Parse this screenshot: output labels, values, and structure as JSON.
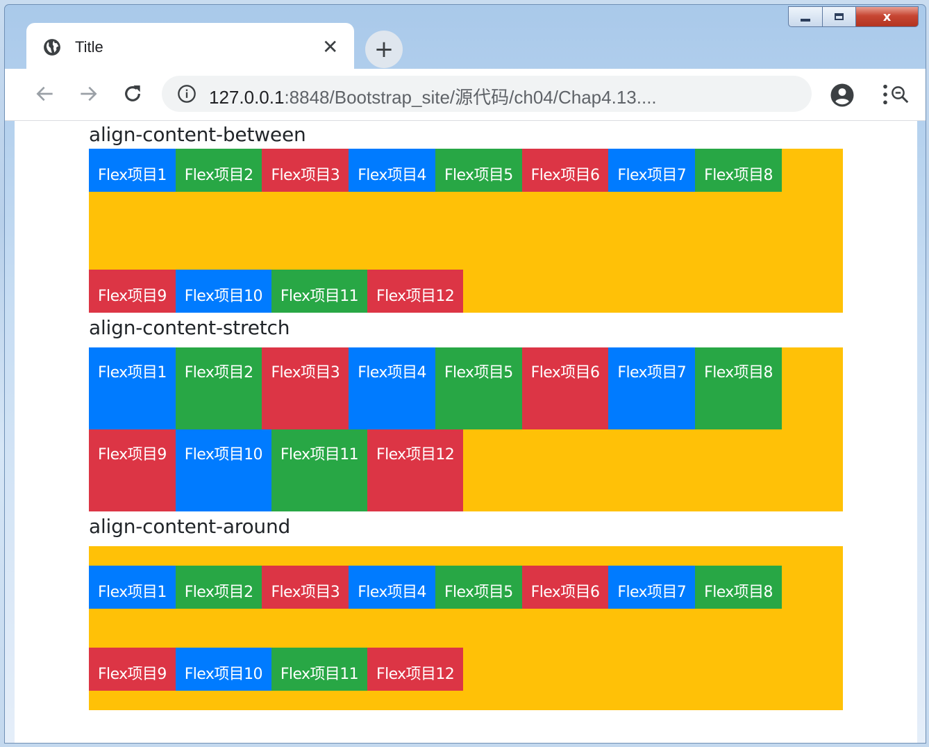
{
  "browser": {
    "tab_title": "Title",
    "tab_close": "✕",
    "new_tab": "+",
    "url_host": "127.0.0.1",
    "url_path": ":8848/Bootstrap_site/源代码/ch04/Chap4.13....",
    "window_buttons": {
      "minimize": "",
      "maximize": "",
      "close": "x"
    }
  },
  "colors": {
    "blue": "#007bff",
    "green": "#28a745",
    "red": "#dc3545",
    "container": "#ffc107"
  },
  "sections": [
    {
      "heading": "align-content-between",
      "items": [
        "Flex项目1",
        "Flex项目2",
        "Flex项目3",
        "Flex项目4",
        "Flex项目5",
        "Flex项目6",
        "Flex项目7",
        "Flex项目8",
        "Flex项目9",
        "Flex项目10",
        "Flex项目11",
        "Flex项目12"
      ]
    },
    {
      "heading": "align-content-stretch",
      "items": [
        "Flex项目1",
        "Flex项目2",
        "Flex项目3",
        "Flex项目4",
        "Flex项目5",
        "Flex项目6",
        "Flex项目7",
        "Flex项目8",
        "Flex项目9",
        "Flex项目10",
        "Flex项目11",
        "Flex项目12"
      ]
    },
    {
      "heading": "align-content-around",
      "items": [
        "Flex项目1",
        "Flex项目2",
        "Flex项目3",
        "Flex项目4",
        "Flex项目5",
        "Flex项目6",
        "Flex项目7",
        "Flex项目8",
        "Flex项目9",
        "Flex项目10",
        "Flex项目11",
        "Flex项目12"
      ]
    }
  ]
}
